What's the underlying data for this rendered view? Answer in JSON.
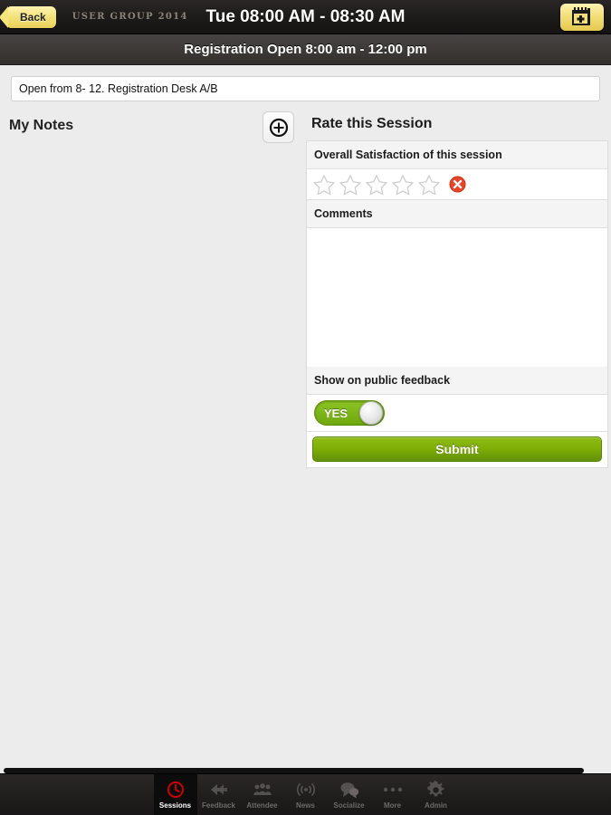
{
  "topbar": {
    "back_label": "Back",
    "brand": "USER GROUP 2014",
    "title": "Tue 08:00 AM - 08:30 AM",
    "calendar_icon": "calendar-add-icon"
  },
  "subbar": {
    "title": "Registration Open 8:00 am - 12:00 pm"
  },
  "note_field": {
    "value": "Open from 8- 12. Registration Desk A/B",
    "placeholder": ""
  },
  "notes": {
    "title": "My Notes",
    "add_icon": "circle-plus-icon"
  },
  "rate": {
    "title": "Rate this Session",
    "satisfaction_label": "Overall Satisfaction of this session",
    "stars_total": 5,
    "stars_selected": 0,
    "clear_icon": "clear-rating-icon",
    "comments_label": "Comments",
    "comments_value": "",
    "comments_placeholder": "",
    "public_feedback_label": "Show on public feedback",
    "toggle_value": "YES",
    "submit_label": "Submit"
  },
  "colors": {
    "accent_yellow": "#f5e47c",
    "green": "#7fae06",
    "red_clear": "#e8442a",
    "active_tab_red": "#cc0000",
    "bar_dark": "#1d1b1a"
  },
  "tabs": [
    {
      "label": "Sessions",
      "icon": "clock-icon",
      "active": true
    },
    {
      "label": "Feedback",
      "icon": "reply-arrows-icon",
      "active": false
    },
    {
      "label": "Attendee",
      "icon": "people-icon",
      "active": false
    },
    {
      "label": "News",
      "icon": "broadcast-icon",
      "active": false
    },
    {
      "label": "Socialize",
      "icon": "speech-bubbles-icon",
      "active": false
    },
    {
      "label": "More",
      "icon": "ellipsis-icon",
      "active": false
    },
    {
      "label": "Admin",
      "icon": "gear-icon",
      "active": false
    }
  ]
}
